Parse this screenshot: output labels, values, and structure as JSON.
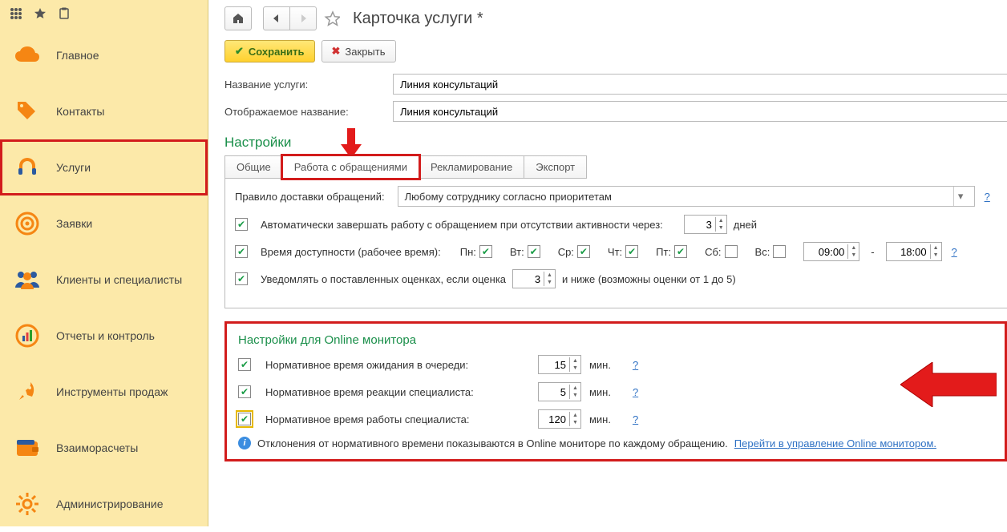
{
  "header": {
    "title": "Карточка услуги *"
  },
  "actions": {
    "save": "Сохранить",
    "close": "Закрыть"
  },
  "fields": {
    "service_name_label": "Название услуги:",
    "service_name_value": "Линия консультаций",
    "display_name_label": "Отображаемое название:",
    "display_name_value": "Линия консультаций"
  },
  "section_settings": "Настройки",
  "tabs": {
    "general": "Общие",
    "requests": "Работа с обращениями",
    "ads": "Рекламирование",
    "export": "Экспорт"
  },
  "delivery": {
    "label": "Правило доставки обращений:",
    "value": "Любому сотруднику согласно приоритетам"
  },
  "auto_close": {
    "label": "Автоматически завершать работу с обращением при отсутствии активности через:",
    "value": "3",
    "unit": "дней"
  },
  "availability": {
    "label": "Время доступности (рабочее время):",
    "days": {
      "mon": "Пн:",
      "tue": "Вт:",
      "wed": "Ср:",
      "thu": "Чт:",
      "fri": "Пт:",
      "sat": "Сб:",
      "sun": "Вс:"
    },
    "from": "09:00",
    "dash": "-",
    "to": "18:00"
  },
  "rating": {
    "label": "Уведомлять о поставленных оценках, если оценка",
    "value": "3",
    "suffix": "и ниже (возможны оценки от 1 до 5)"
  },
  "online": {
    "title": "Настройки для Online монитора",
    "wait": {
      "label": "Нормативное время ожидания в очереди:",
      "value": "15",
      "unit": "мин."
    },
    "react": {
      "label": "Нормативное время реакции специалиста:",
      "value": "5",
      "unit": "мин."
    },
    "work": {
      "label": "Нормативное время работы специалиста:",
      "value": "120",
      "unit": "мин."
    },
    "info": "Отклонения от нормативного времени показываются в Online мониторе по каждому обращению.",
    "link": "Перейти в управление Online монитором."
  },
  "help": "?",
  "sidebar": {
    "items": [
      {
        "label": "Главное"
      },
      {
        "label": "Контакты"
      },
      {
        "label": "Услуги"
      },
      {
        "label": "Заявки"
      },
      {
        "label": "Клиенты и специалисты"
      },
      {
        "label": "Отчеты и контроль"
      },
      {
        "label": "Инструменты продаж"
      },
      {
        "label": "Взаиморасчеты"
      },
      {
        "label": "Администрирование"
      }
    ]
  }
}
